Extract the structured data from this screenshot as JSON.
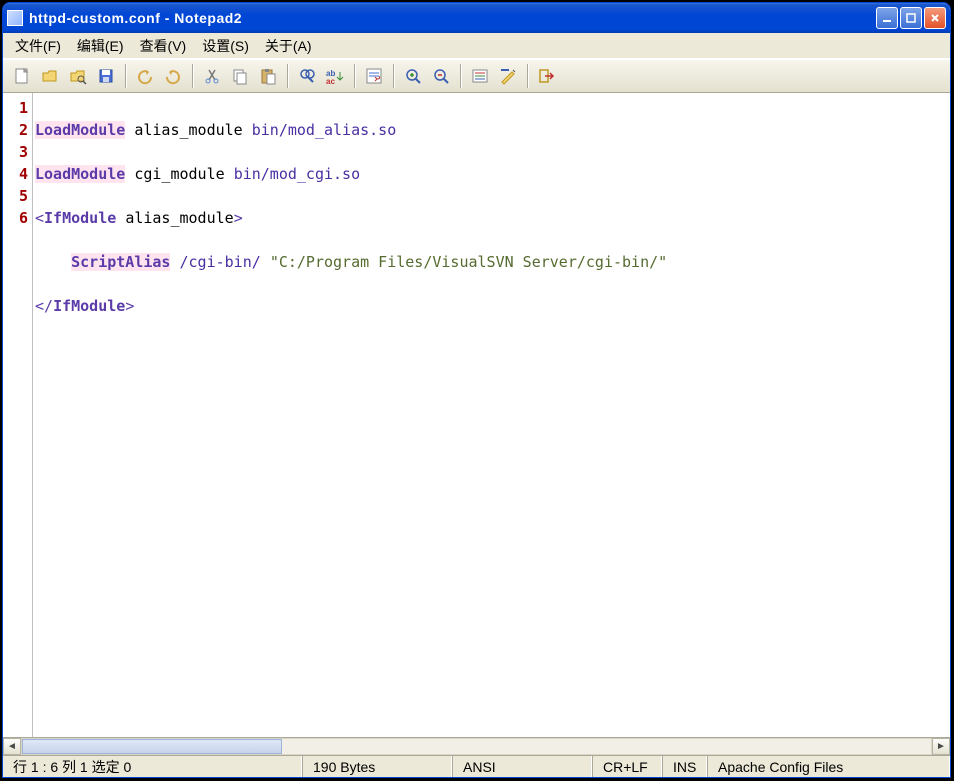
{
  "window": {
    "title": "httpd-custom.conf - Notepad2"
  },
  "menu": {
    "file": "文件(F)",
    "edit": "编辑(E)",
    "view": "查看(V)",
    "settings": "设置(S)",
    "about": "关于(A)"
  },
  "code": {
    "lines": [
      {
        "n": "1",
        "raw": "LoadModule alias_module bin/mod_alias.so"
      },
      {
        "n": "2",
        "raw": "LoadModule cgi_module bin/mod_cgi.so"
      },
      {
        "n": "3",
        "raw": "<IfModule alias_module>"
      },
      {
        "n": "4",
        "raw": "    ScriptAlias /cgi-bin/ \"C:/Program Files/VisualSVN Server/cgi-bin/\""
      },
      {
        "n": "5",
        "raw": "</IfModule>"
      },
      {
        "n": "6",
        "raw": ""
      }
    ],
    "tokens": {
      "l1_kw": "LoadModule",
      "l1_mod": "alias_module",
      "l1_path": "bin/mod_alias.so",
      "l2_kw": "LoadModule",
      "l2_mod": "cgi_module",
      "l2_path": "bin/mod_cgi.so",
      "l3_open": "<",
      "l3_tag": "IfModule",
      "l3_arg": "alias_module",
      "l3_close": ">",
      "l4_indent": "    ",
      "l4_kw": "ScriptAlias",
      "l4_p1": "/cgi-bin/",
      "l4_str": "\"C:/Program Files/VisualSVN Server/cgi-bin/\"",
      "l5_open": "</",
      "l5_tag": "IfModule",
      "l5_close": ">"
    }
  },
  "status": {
    "pos": "行 1 : 6   列 1   选定 0",
    "size": "190 Bytes",
    "enc": "ANSI",
    "eol": "CR+LF",
    "ins": "INS",
    "type": "Apache Config Files"
  },
  "toolbar_icons": [
    "new",
    "open",
    "browse",
    "save",
    "undo",
    "redo",
    "cut",
    "copy",
    "paste",
    "find",
    "replace",
    "word-wrap",
    "zoom-in",
    "zoom-out",
    "options",
    "settings",
    "exit"
  ]
}
